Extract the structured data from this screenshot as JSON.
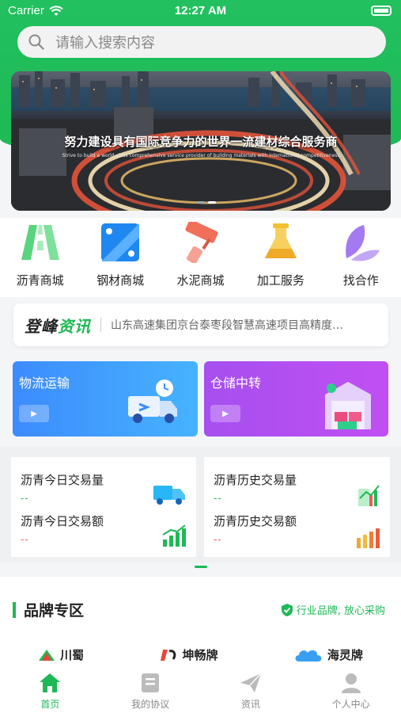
{
  "status_bar": {
    "carrier": "Carrier",
    "time": "12:27 AM"
  },
  "search": {
    "placeholder": "请输入搜索内容"
  },
  "banner": {
    "headline": "努力建设具有国际竞争力的世界一流建材综合服务商",
    "subline": "Strive to build a world-class comprehensive service provider of building materials with international competitiveness"
  },
  "categories": [
    {
      "label": "沥青商城",
      "icon": "road-icon"
    },
    {
      "label": "钢材商城",
      "icon": "steel-plate-icon"
    },
    {
      "label": "水泥商城",
      "icon": "paint-roller-icon"
    },
    {
      "label": "加工服务",
      "icon": "flask-icon"
    },
    {
      "label": "找合作",
      "icon": "leaf-icon"
    }
  ],
  "news": {
    "brand_part1": "登峰",
    "brand_part2": "资讯",
    "headline": "山东高速集团京台泰枣段智慧高速项目高精度…"
  },
  "services": [
    {
      "title": "物流运输"
    },
    {
      "title": "仓储中转"
    }
  ],
  "stats": {
    "today_volume": {
      "label": "沥青今日交易量",
      "value": "--"
    },
    "today_amount": {
      "label": "沥青今日交易额",
      "value": "--"
    },
    "history_volume": {
      "label": "沥青历史交易量",
      "value": "--"
    },
    "history_amount": {
      "label": "沥青历史交易额",
      "value": "--"
    }
  },
  "brand_zone": {
    "title": "品牌专区",
    "tagline": "行业品牌, 放心采购",
    "logos": [
      "川蜀",
      "坤畅牌",
      "海灵牌"
    ]
  },
  "tabbar": [
    {
      "label": "首页",
      "active": true
    },
    {
      "label": "我的协议",
      "active": false
    },
    {
      "label": "资讯",
      "active": false
    },
    {
      "label": "个人中心",
      "active": false
    }
  ],
  "colors": {
    "primary": "#1db954",
    "logistics": "#3d8bfd",
    "storage": "#b04ff1",
    "dash_green": "#1db954",
    "dash_red": "#f05a5a"
  }
}
